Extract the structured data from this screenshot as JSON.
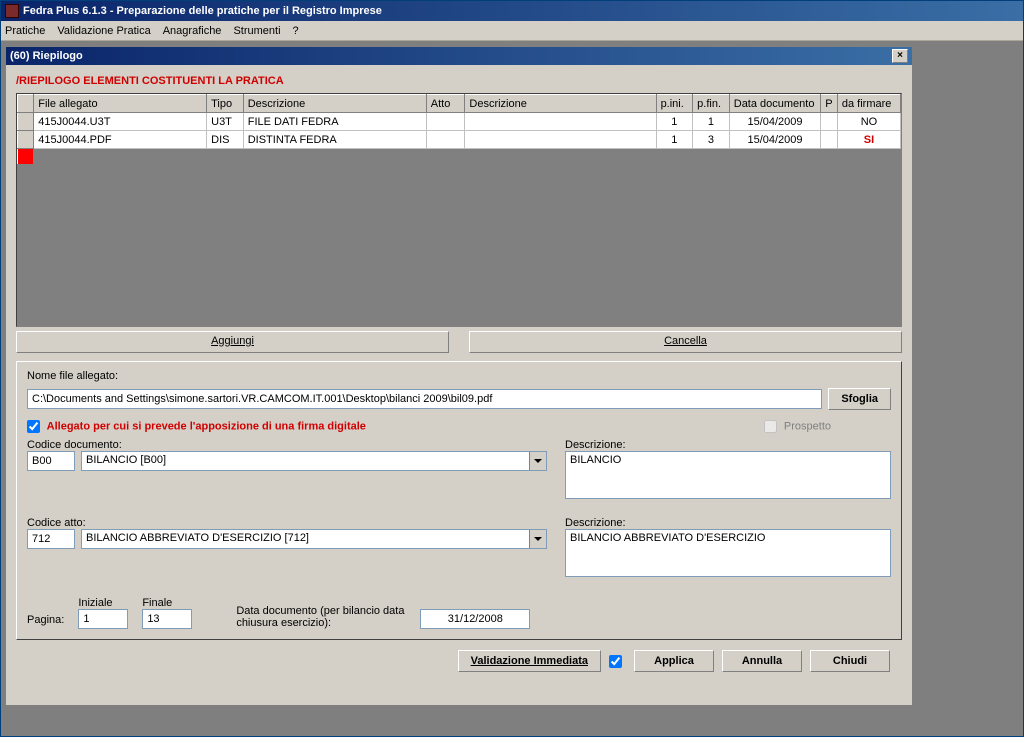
{
  "app": {
    "title": "Fedra Plus 6.1.3 - Preparazione delle pratiche per il Registro Imprese"
  },
  "menu": [
    "Pratiche",
    "Validazione Pratica",
    "Anagrafiche",
    "Strumenti",
    "?"
  ],
  "dialog": {
    "title": "(60) Riepilogo",
    "section_title": "/RIEPILOGO ELEMENTI COSTITUENTI LA PRATICA"
  },
  "grid": {
    "headers": {
      "file": "File allegato",
      "tipo": "Tipo",
      "desc1": "Descrizione",
      "atto": "Atto",
      "desc2": "Descrizione",
      "pini": "p.ini.",
      "pfin": "p.fin.",
      "datadoc": "Data documento",
      "p": "P",
      "firma": "da firmare"
    },
    "rows": [
      {
        "file": "415J0044.U3T",
        "tipo": "U3T",
        "desc1": "FILE DATI FEDRA",
        "atto": "",
        "desc2": "",
        "pini": "1",
        "pfin": "1",
        "datadoc": "15/04/2009",
        "p": "",
        "firma": "NO",
        "firma_si": false
      },
      {
        "file": "415J0044.PDF",
        "tipo": "DIS",
        "desc1": "DISTINTA FEDRA",
        "atto": "",
        "desc2": "",
        "pini": "1",
        "pfin": "3",
        "datadoc": "15/04/2009",
        "p": "",
        "firma": "SI",
        "firma_si": true
      }
    ]
  },
  "buttons": {
    "aggiungi": "Aggiungi",
    "cancella": "Cancella",
    "sfoglia": "Sfoglia",
    "validazione": "Validazione Immediata",
    "applica": "Applica",
    "annulla": "Annulla",
    "chiudi": "Chiudi"
  },
  "form": {
    "nome_label": "Nome file allegato:",
    "nome_value": "C:\\Documents and Settings\\simone.sartori.VR.CAMCOM.IT.001\\Desktop\\bilanci 2009\\bil09.pdf",
    "firma_chk_label": "Allegato per cui si prevede l'apposizione di una firma digitale",
    "prospetto_label": "Prospetto",
    "codice_doc_label": "Codice documento:",
    "codice_doc_code": "B00",
    "codice_doc_select": "BILANCIO [B00]",
    "descrizione_label": "Descrizione:",
    "descrizione_doc": "BILANCIO",
    "codice_atto_label": "Codice atto:",
    "codice_atto_code": "712",
    "codice_atto_select": "BILANCIO ABBREVIATO D'ESERCIZIO [712]",
    "descrizione_atto": "BILANCIO ABBREVIATO D'ESERCIZIO",
    "pagina_label": "Pagina:",
    "iniziale_label": "Iniziale",
    "finale_label": "Finale",
    "iniziale_val": "1",
    "finale_val": "13",
    "data_doc_label": "Data documento (per bilancio data chiusura esercizio):",
    "data_doc_val": "31/12/2008"
  }
}
